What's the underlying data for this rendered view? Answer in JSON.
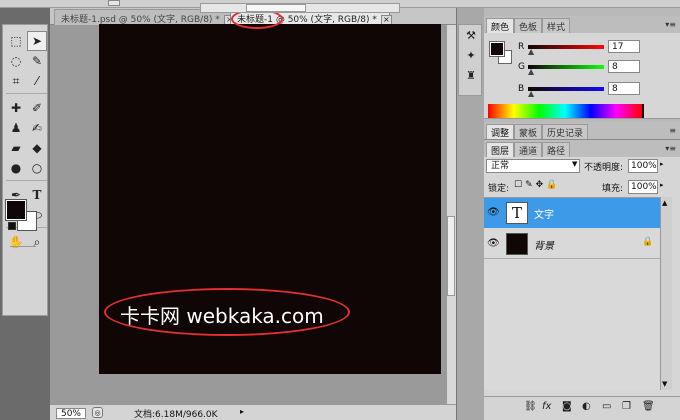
{
  "document": {
    "tabs": [
      {
        "label": "未标题-1.psd @ 50% (文字, RGB/8) *",
        "active": false
      },
      {
        "label": "未标题-1 @ 50% (文字, RGB/8) *",
        "active": true
      }
    ],
    "canvas_color": "#100606",
    "watermark_text": "卡卡网 webkaka.com"
  },
  "status": {
    "zoom": "50%",
    "doc_info": "文档:6.18M/966.0K"
  },
  "tools": {
    "foreground_color": "#110606",
    "background_color": "#ffffff",
    "items": [
      "marquee-tool",
      "move-tool",
      "lasso-tool",
      "quick-select-tool",
      "crop-tool",
      "eyedropper-tool",
      "healing-brush-tool",
      "brush-tool",
      "clone-stamp-tool",
      "history-brush-tool",
      "eraser-tool",
      "paint-bucket-tool",
      "blur-tool",
      "dodge-tool",
      "pen-tool",
      "type-tool",
      "path-select-tool",
      "ellipse-tool",
      "hand-tool",
      "zoom-tool"
    ]
  },
  "color_panel": {
    "tabs": [
      "颜色",
      "色板",
      "样式"
    ],
    "r_label": "R",
    "g_label": "G",
    "b_label": "B",
    "r": "17",
    "g": "8",
    "b": "8"
  },
  "adjust_panel": {
    "tabs": [
      "调整",
      "蒙板",
      "历史记录"
    ]
  },
  "layers_panel": {
    "tabs": [
      "图层",
      "通道",
      "路径"
    ],
    "blend_mode": "正常",
    "opacity_label": "不透明度:",
    "opacity": "100%",
    "lock_label": "锁定:",
    "fill_label": "填充:",
    "fill": "100%",
    "layers": [
      {
        "name": "文字",
        "type": "text",
        "selected": true,
        "thumb_glyph": "T"
      },
      {
        "name": "背景",
        "type": "background",
        "selected": false
      }
    ]
  },
  "highlight_color": "#e03030",
  "accent_color": "#3d9ae8"
}
